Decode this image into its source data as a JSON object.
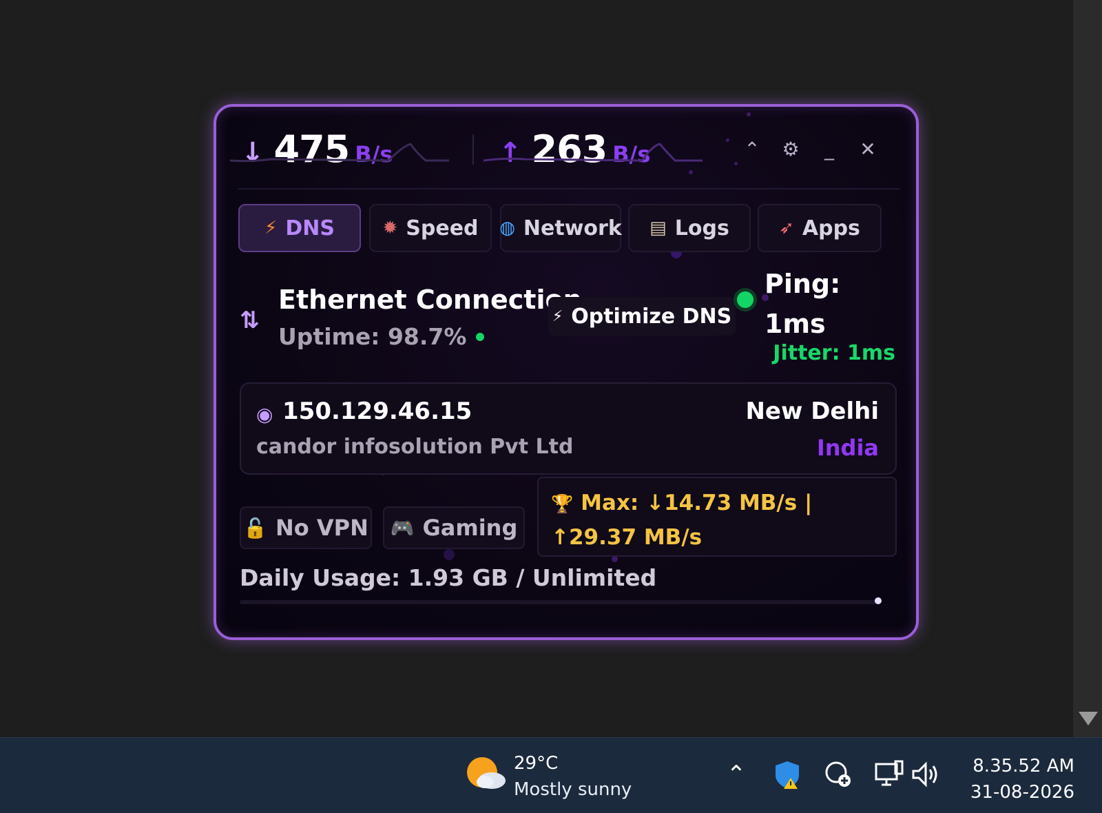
{
  "header": {
    "download_value": "475",
    "download_unit": "B/s",
    "upload_value": "263",
    "upload_unit": "B/s",
    "controls": [
      "chevron-up",
      "gear",
      "minimize",
      "close"
    ]
  },
  "tabs": [
    {
      "label": "DNS",
      "icon": "lightning-icon",
      "active": true
    },
    {
      "label": "Speed",
      "icon": "ladybug-icon",
      "active": false
    },
    {
      "label": "Network",
      "icon": "globe-icon",
      "active": false
    },
    {
      "label": "Logs",
      "icon": "document-icon",
      "active": false
    },
    {
      "label": "Apps",
      "icon": "rocket-icon",
      "active": false
    }
  ],
  "connection": {
    "title": "Ethernet Connection",
    "uptime": "Uptime: 98.7%",
    "optimize_label": "Optimize DNS",
    "ping_label": "Ping:",
    "ping_value": "1ms",
    "jitter": "Jitter: 1ms"
  },
  "ip_info": {
    "address": "150.129.46.15",
    "isp": "candor infosolution Pvt Ltd",
    "city": "New Delhi",
    "country": "India"
  },
  "badges": {
    "vpn": "No VPN",
    "mode": "Gaming",
    "max_speed": "Max: ↓14.73 MB/s | ↑29.37 MB/s"
  },
  "usage": {
    "label": "Daily Usage: 1.93 GB / Unlimited",
    "fraction": 0
  },
  "taskbar": {
    "temperature": "29°C",
    "weather": "Mostly sunny",
    "time": "8.35.52 AM",
    "date": "31-08-2026"
  },
  "colors": {
    "accent": "#8a3ff0",
    "border": "#9b5fd6",
    "green": "#14d466",
    "gold": "#f4c443"
  }
}
